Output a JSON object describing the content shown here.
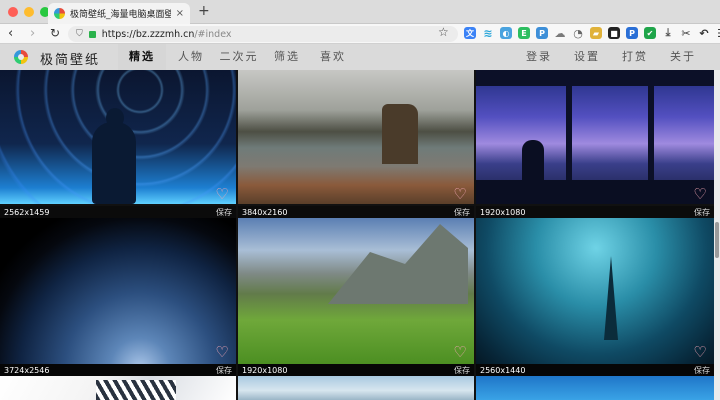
{
  "browser": {
    "tab_title": "极简壁纸_海量电脑桌面壁纸美",
    "tab_close": "×",
    "new_tab": "+",
    "url_host": "https://bz.zzzmh.cn",
    "url_path": "/#index",
    "back": "‹",
    "forward": "›",
    "reload": "↻",
    "bookmark": "☆",
    "extensions": [
      {
        "name": "translate-icon",
        "label": "文",
        "color": "#3b82f6"
      },
      {
        "name": "wifi-icon",
        "label": "≋",
        "color": "#2aa6d9"
      },
      {
        "name": "chat-icon",
        "label": "◐",
        "color": "#4aa3df"
      },
      {
        "name": "evernote-icon",
        "label": "E",
        "color": "#2dbe60"
      },
      {
        "name": "pinterest-icon",
        "label": "P",
        "color": "#3d8fd8"
      },
      {
        "name": "cloud-icon",
        "label": "☁",
        "color": "#7a7a7a"
      },
      {
        "name": "gauge-icon",
        "label": "◔",
        "color": "#666666"
      },
      {
        "name": "folder-icon",
        "label": "▰",
        "color": "#e0b23a"
      },
      {
        "name": "dark-ext-icon",
        "label": "■",
        "color": "#222222"
      },
      {
        "name": "p-ext-icon",
        "label": "P",
        "color": "#2a6fd6"
      },
      {
        "name": "shield-ext-icon",
        "label": "✔",
        "color": "#1fa54a"
      },
      {
        "name": "download-icon",
        "label": "⤓",
        "color": "#555555"
      },
      {
        "name": "scissors-icon",
        "label": "✂",
        "color": "#333333"
      },
      {
        "name": "undo-icon",
        "label": "↶",
        "color": "#333333"
      },
      {
        "name": "menu-icon",
        "label": "☰",
        "color": "#333333"
      }
    ]
  },
  "site": {
    "logo_text": "极简壁纸",
    "nav": [
      {
        "label": "精选",
        "active": true
      },
      {
        "label": "人物",
        "active": false
      },
      {
        "label": "二次元",
        "active": false
      },
      {
        "label": "筛选",
        "active": false
      },
      {
        "label": "喜欢",
        "active": false
      }
    ],
    "right_nav": [
      "登录",
      "设置",
      "打赏",
      "关于"
    ]
  },
  "wallpapers": [
    {
      "resolution": "2562x1459",
      "save": "保存",
      "theme": "star-trails"
    },
    {
      "resolution": "3840x2160",
      "save": "保存",
      "theme": "lake-stump"
    },
    {
      "resolution": "1920x1080",
      "save": "保存",
      "theme": "city-window"
    },
    {
      "resolution": "3724x2546",
      "save": "保存",
      "theme": "earth"
    },
    {
      "resolution": "1920x1080",
      "save": "保存",
      "theme": "alpine-meadow"
    },
    {
      "resolution": "2560x1440",
      "save": "保存",
      "theme": "underwater-city"
    },
    {
      "resolution": "",
      "save": "",
      "theme": "white-abstract"
    },
    {
      "resolution": "",
      "save": "",
      "theme": "sky-lake"
    },
    {
      "resolution": "",
      "save": "",
      "theme": "blue-gradient"
    }
  ],
  "heart_glyph": "♡"
}
